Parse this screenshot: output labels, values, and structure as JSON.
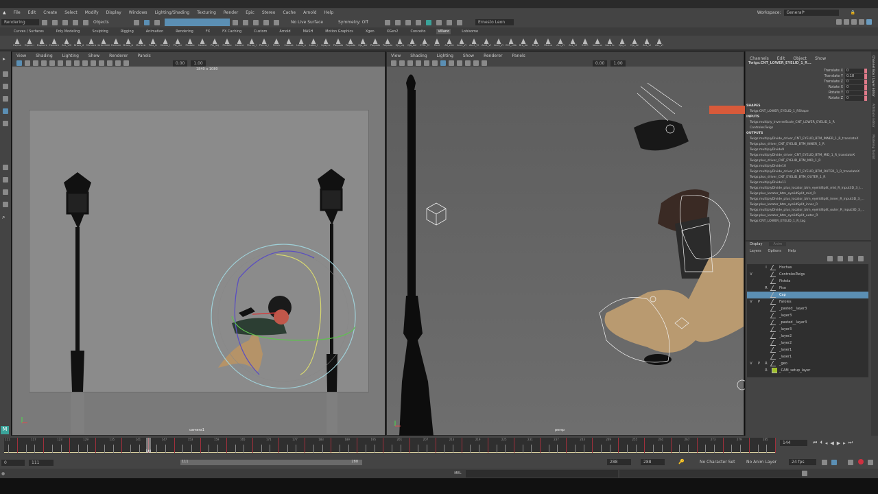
{
  "menubar": [
    "File",
    "Edit",
    "Create",
    "Select",
    "Modify",
    "Display",
    "Windows",
    "Lighting/Shading",
    "Texturing",
    "Render",
    "Epic",
    "Stereo",
    "Cache",
    "Arnold",
    "Help"
  ],
  "workspace": {
    "label": "Workspace:",
    "value": "General*"
  },
  "status_line": {
    "mode": "Rendering",
    "objects": "Objects",
    "live_surface": "No Live Surface",
    "symmetry": "Symmetry: Off",
    "user": "Ernesto Leon"
  },
  "shelf_tabs": [
    "Curves / Surfaces",
    "Poly Modeling",
    "Sculpting",
    "Rigging",
    "Animation",
    "Rendering",
    "FX",
    "FX Caching",
    "Custom",
    "Arnold",
    "MASH",
    "Motion Graphics",
    "Xgen",
    "XGen2",
    "Conceito",
    "Villano",
    "Lobisome"
  ],
  "shelf_tab_active": "Villano",
  "shelf_items": [
    "Espina",
    "Espina r",
    "Espina s",
    "Hombro",
    "ALL_VIII",
    "Brazo_d",
    "Muñeca",
    "Pela de Dedos",
    "Hombro",
    "Brazo_iz",
    "Muñeca",
    "Pela_iz",
    "Dedos_i",
    "Pie_der",
    "Pantalo",
    "Cadera",
    "Pie_izq",
    "Pantalo",
    "Cadera",
    "Pierna_l",
    "Pierna_r",
    "Pelvis",
    "Cabeza",
    "Labio_u",
    "Labio_l",
    "Lipsync",
    "Parpado",
    "Parpado",
    "Ojo_der",
    "Parpado",
    "Parpado",
    "Ojo_izq",
    "Ojo_der",
    "CTRL_M",
    "Root",
    "All_ville",
    "ALL2_VI",
    "ALL3_VI",
    "ALL4_VI",
    "ALL5_VI",
    "EXP_villa",
    "Bra_da",
    "Bra_iz",
    "Villano",
    "ALL_VI",
    "ALL_VI",
    "EXPR",
    "boca ac",
    "boca fu",
    "Ojo_iz",
    "Ojo_de",
    "ALL_VI",
    "ALL_VI"
  ],
  "viewports": [
    {
      "menus": [
        "View",
        "Shading",
        "Lighting",
        "Show",
        "Renderer",
        "Panels"
      ],
      "camera": "camera1",
      "resolution": "1840 x 1080",
      "field1": "0.00",
      "field2": "1.00"
    },
    {
      "menus": [
        "View",
        "Shading",
        "Lighting",
        "Show",
        "Renderer",
        "Panels"
      ],
      "camera": "persp",
      "field1": "0.00",
      "field2": "1.00"
    }
  ],
  "channel_box": {
    "menus": [
      "Channels",
      "Edit",
      "Object",
      "Show"
    ],
    "object": "Twigs:CNT_LOWER_EYELID_1_R...",
    "channels": [
      {
        "name": "Translate X",
        "value": "0"
      },
      {
        "name": "Translate Y",
        "value": "0.18"
      },
      {
        "name": "Translate Z",
        "value": "0"
      },
      {
        "name": "Rotate X",
        "value": "0"
      },
      {
        "name": "Rotate Y",
        "value": "0"
      },
      {
        "name": "Rotate Z",
        "value": "0"
      }
    ],
    "shapes_label": "SHAPES",
    "shapes": [
      "Twigs:CNT_LOWER_EYELID_1_RShape"
    ],
    "inputs_label": "INPUTS",
    "inputs": [
      "Twigs:multiply_inverseScale_CNT_LOWER_EYELID_1_R",
      "ControlesTwigs"
    ],
    "outputs_label": "OUTPUTS",
    "outputs": [
      "Twigs:multiplyDivide_driver_CNT_EYELID_BTM_INNER_1_R_translateX",
      "Twigs:plus_driver_CNT_EYELID_BTM_INNER_1_R",
      "Twigs:multiplyDivide9",
      "Twigs:multiplyDivide_driver_CNT_EYELID_BTM_MID_1_R_translateX",
      "Twigs:plus_driver_CNT_EYELID_BTM_MID_1_R",
      "Twigs:multiplyDivide10",
      "Twigs:multiplyDivide_driver_CNT_EYELID_BTM_OUTER_1_R_translateX",
      "Twigs:plus_driver_CNT_EYELID_BTM_OUTER_1_R",
      "Twigs:multiplyDivide11",
      "Twigs:multiplyDivide_plus_locator_btm_eyelidSplit_mid_R_input3D_3_i...",
      "Twigs:plus_locator_btm_eyelidSplit_mid_R",
      "Twigs:multiplyDivide_plus_locator_btm_eyelidSplit_inner_R_input3D_3_...",
      "Twigs:plus_locator_btm_eyelidSplit_inner_R",
      "Twigs:multiplyDivide_plus_locator_btm_eyelidSplit_outer_R_input3D_3_...",
      "Twigs:plus_locator_btm_eyelidSplit_outer_R",
      "Twigs:CNT_LOWER_EYELID_1_R_tag"
    ]
  },
  "side_tabs": [
    "Channel Box / Layer Editor",
    "Attribute Editor",
    "Modeling Toolkit"
  ],
  "layer_editor": {
    "tabs": [
      "Display",
      "Anim"
    ],
    "menus": [
      "Layers",
      "Options",
      "Help"
    ],
    "layers": [
      {
        "v": "",
        "p": "",
        "r": "I",
        "name": "Hochas"
      },
      {
        "v": "V",
        "p": "",
        "r": "",
        "name": "ControlesTwigs"
      },
      {
        "v": "",
        "p": "",
        "r": "",
        "name": "Pistola"
      },
      {
        "v": "",
        "p": "",
        "r": "R",
        "name": "Piso"
      },
      {
        "v": "",
        "p": "",
        "r": "",
        "name": "Cap",
        "selected": true
      },
      {
        "v": "V",
        "p": "P",
        "r": "",
        "name": "Faroles"
      },
      {
        "v": "",
        "p": "",
        "r": "",
        "name": "_pasted__layer3"
      },
      {
        "v": "",
        "p": "",
        "r": "",
        "name": "_layer3"
      },
      {
        "v": "",
        "p": "",
        "r": "",
        "name": "_pasted__layer3"
      },
      {
        "v": "",
        "p": "",
        "r": "",
        "name": "_layer3"
      },
      {
        "v": "",
        "p": "",
        "r": "",
        "name": "_layer2"
      },
      {
        "v": "",
        "p": "",
        "r": "",
        "name": "_layer2"
      },
      {
        "v": "",
        "p": "",
        "r": "",
        "name": "_layer1"
      },
      {
        "v": "",
        "p": "",
        "r": "",
        "name": "_layer1"
      },
      {
        "v": "V",
        "p": "P",
        "r": "R",
        "name": "_geo"
      },
      {
        "v": "",
        "p": "",
        "r": "R",
        "name": "_CAM_setup_layer",
        "color": "#9fbf2a"
      }
    ]
  },
  "timeline": {
    "start": 111,
    "end": 288,
    "current": 144,
    "current_field": "144",
    "range_start": "0",
    "playback_start": "111",
    "slider_start": "111",
    "slider_end": "288",
    "anim_end": "288",
    "playback_end": "288",
    "character_set": "No Character Set",
    "anim_layer": "No Anim Layer",
    "fps": "24 fps"
  },
  "command_line": {
    "label": "MEL"
  },
  "colors": {
    "accent": "#5b8fb4",
    "key": "#b03040",
    "panel": "#444444"
  }
}
